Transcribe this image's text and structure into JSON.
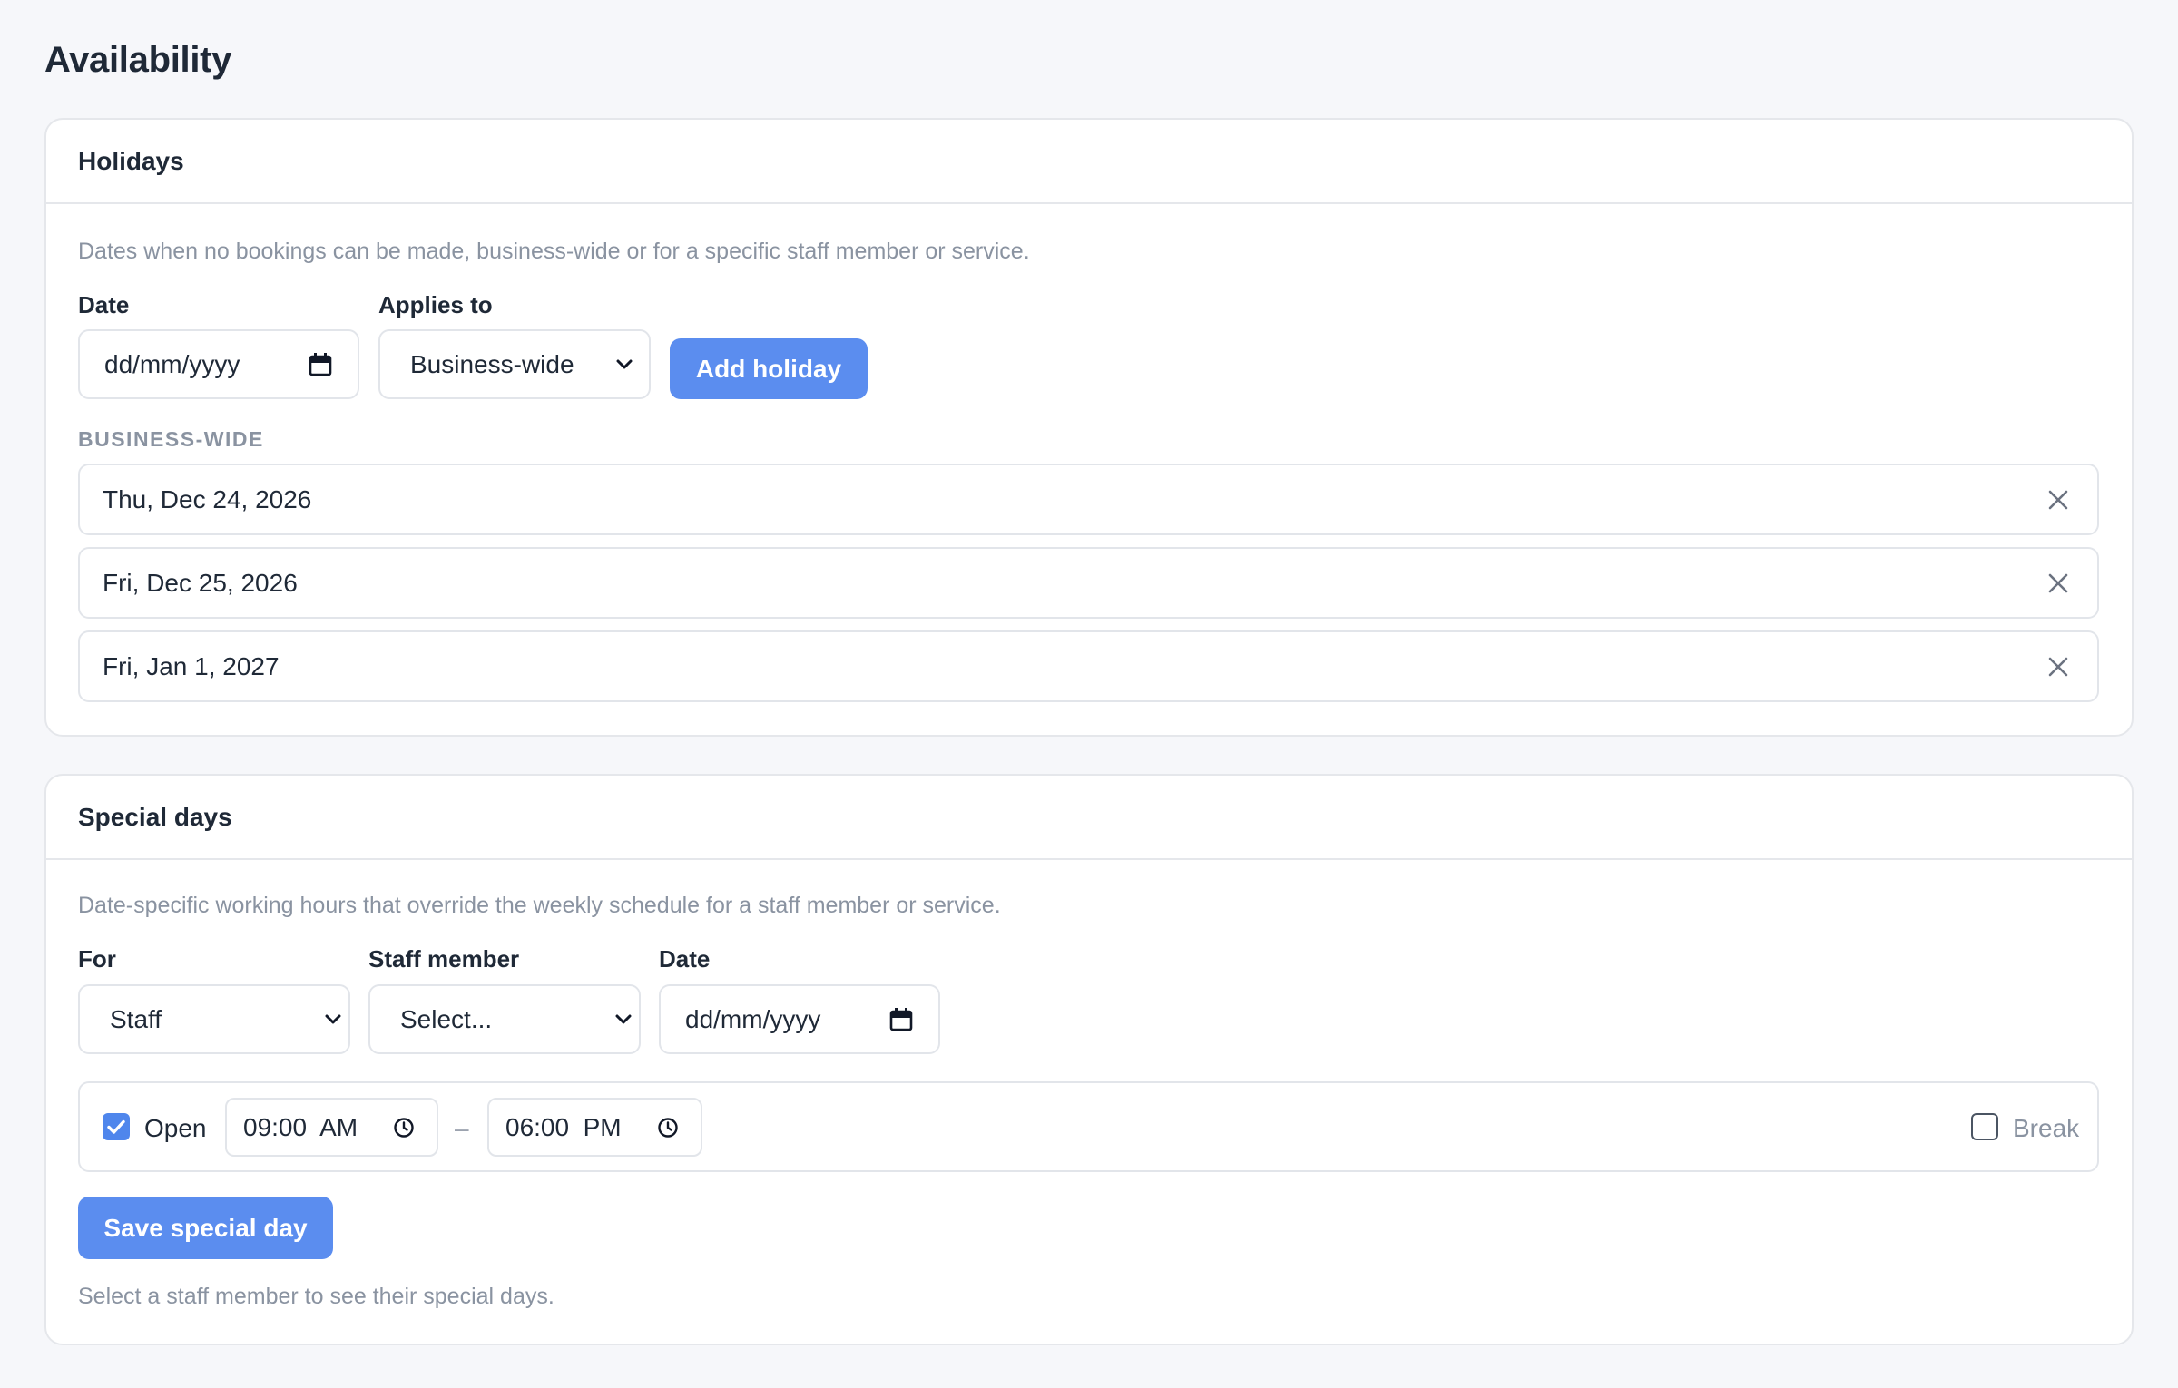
{
  "page": {
    "title": "Availability"
  },
  "holidays": {
    "title": "Holidays",
    "description": "Dates when no bookings can be made, business-wide or for a specific staff member or service.",
    "date_label": "Date",
    "date_placeholder": "dd/mm/yyyy",
    "applies_label": "Applies to",
    "applies_value": "Business-wide",
    "add_button": "Add holiday",
    "group_label": "BUSINESS-WIDE",
    "items": [
      {
        "date": "Thu, Dec 24, 2026"
      },
      {
        "date": "Fri, Dec 25, 2026"
      },
      {
        "date": "Fri, Jan 1, 2027"
      }
    ]
  },
  "special_days": {
    "title": "Special days",
    "description": "Date-specific working hours that override the weekly schedule for a staff member or service.",
    "for_label": "For",
    "for_value": "Staff",
    "staff_label": "Staff member",
    "staff_value": "Select...",
    "date_label": "Date",
    "date_placeholder": "dd/mm/yyyy",
    "open_label": "Open",
    "open_checked": true,
    "start_time": "09:00  AM",
    "separator": "–",
    "end_time": "06:00  PM",
    "break_label": "Break",
    "break_checked": false,
    "save_button": "Save special day",
    "footnote": "Select a staff member to see their special days."
  },
  "colors": {
    "accent": "#5b8def",
    "background": "#f6f7fa",
    "muted_text": "#8a93a1"
  }
}
